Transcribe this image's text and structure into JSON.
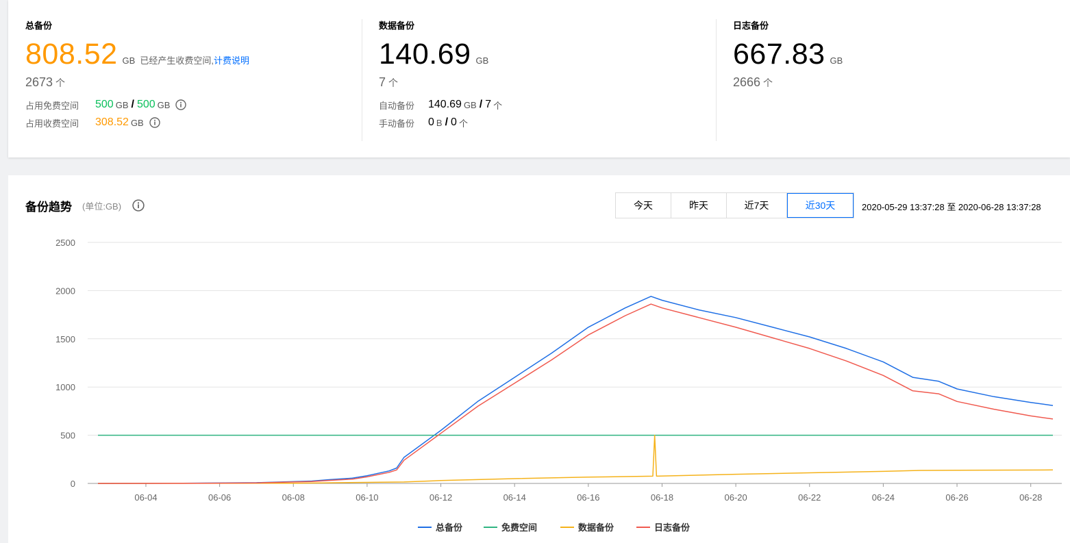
{
  "summary": {
    "total": {
      "title": "总备份",
      "value": "808.52",
      "unit": "GB",
      "note": "已经产生收费空间,",
      "link": "计费说明",
      "count": "2673",
      "count_unit": "个",
      "free_label": "占用免费空间",
      "free_used": "500",
      "free_used_unit": "GB",
      "free_total": "500",
      "free_total_unit": "GB",
      "paid_label": "占用收费空间",
      "paid_value": "308.52",
      "paid_unit": "GB"
    },
    "data": {
      "title": "数据备份",
      "value": "140.69",
      "unit": "GB",
      "count": "7",
      "count_unit": "个",
      "auto_label": "自动备份",
      "auto_size": "140.69",
      "auto_size_unit": "GB",
      "auto_count": "7",
      "auto_count_unit": "个",
      "manual_label": "手动备份",
      "manual_size": "0",
      "manual_size_unit": "B",
      "manual_count": "0",
      "manual_count_unit": "个"
    },
    "log": {
      "title": "日志备份",
      "value": "667.83",
      "unit": "GB",
      "count": "2666",
      "count_unit": "个"
    }
  },
  "trend": {
    "title": "备份趋势",
    "unit_note": "(单位:GB)",
    "ranges": [
      "今天",
      "昨天",
      "近7天",
      "近30天"
    ],
    "active_range": 3,
    "date_range": "2020-05-29 13:37:28 至 2020-06-28 13:37:28"
  },
  "colors": {
    "total": "#1f6fe5",
    "free": "#2fb481",
    "data": "#f5b21a",
    "log": "#f05a4f",
    "orange": "#ff9900",
    "green": "#0abf5b",
    "link": "#006eff"
  },
  "chart_data": {
    "type": "line",
    "title": "",
    "xlabel": "",
    "ylabel": "",
    "ylim": [
      0,
      2500
    ],
    "yticks": [
      0,
      500,
      1000,
      1500,
      2000,
      2500
    ],
    "xticks": [
      "06-04",
      "06-06",
      "06-08",
      "06-10",
      "06-12",
      "06-14",
      "06-16",
      "06-18",
      "06-20",
      "06-22",
      "06-24",
      "06-26",
      "06-28"
    ],
    "x_numeric_ticks": [
      4,
      6,
      8,
      10,
      12,
      14,
      16,
      18,
      20,
      22,
      24,
      26,
      28
    ],
    "x_range_days": [
      2.7,
      28.6
    ],
    "legend_position": "bottom",
    "series": [
      {
        "name": "总备份",
        "color": "#1f6fe5",
        "x": [
          2.7,
          5.0,
          7.0,
          8.5,
          9.0,
          9.6,
          10.0,
          10.6,
          10.8,
          11.0,
          12.0,
          13.0,
          14.0,
          15.0,
          16.0,
          17.0,
          17.7,
          18.0,
          19.0,
          20.0,
          21.0,
          22.0,
          23.0,
          24.0,
          24.8,
          25.5,
          26.0,
          27.0,
          28.0,
          28.6
        ],
        "values": [
          0,
          2,
          8,
          25,
          40,
          55,
          80,
          130,
          160,
          270,
          550,
          850,
          1100,
          1350,
          1620,
          1820,
          1940,
          1900,
          1800,
          1720,
          1620,
          1520,
          1400,
          1260,
          1100,
          1060,
          980,
          900,
          840,
          808
        ]
      },
      {
        "name": "免费空间",
        "color": "#2fb481",
        "x": [
          2.7,
          28.6
        ],
        "values": [
          500,
          500
        ]
      },
      {
        "name": "数据备份",
        "color": "#f5b21a",
        "x": [
          2.7,
          8.0,
          11.0,
          12.0,
          14.0,
          16.0,
          17.75,
          17.8,
          17.85,
          20.0,
          22.0,
          24.0,
          25.0,
          28.6
        ],
        "values": [
          0,
          2,
          15,
          30,
          50,
          65,
          75,
          500,
          75,
          95,
          110,
          125,
          135,
          140
        ]
      },
      {
        "name": "日志备份",
        "color": "#f05a4f",
        "x": [
          2.7,
          5.0,
          7.0,
          8.5,
          9.0,
          9.6,
          10.0,
          10.6,
          10.8,
          11.0,
          12.0,
          13.0,
          14.0,
          15.0,
          16.0,
          17.0,
          17.7,
          18.0,
          19.0,
          20.0,
          21.0,
          22.0,
          23.0,
          24.0,
          24.8,
          25.5,
          26.0,
          27.0,
          28.0,
          28.6
        ],
        "values": [
          0,
          1,
          6,
          20,
          32,
          45,
          68,
          115,
          140,
          240,
          520,
          800,
          1040,
          1280,
          1540,
          1740,
          1860,
          1820,
          1720,
          1620,
          1510,
          1400,
          1270,
          1120,
          960,
          930,
          850,
          770,
          700,
          668
        ]
      }
    ]
  }
}
